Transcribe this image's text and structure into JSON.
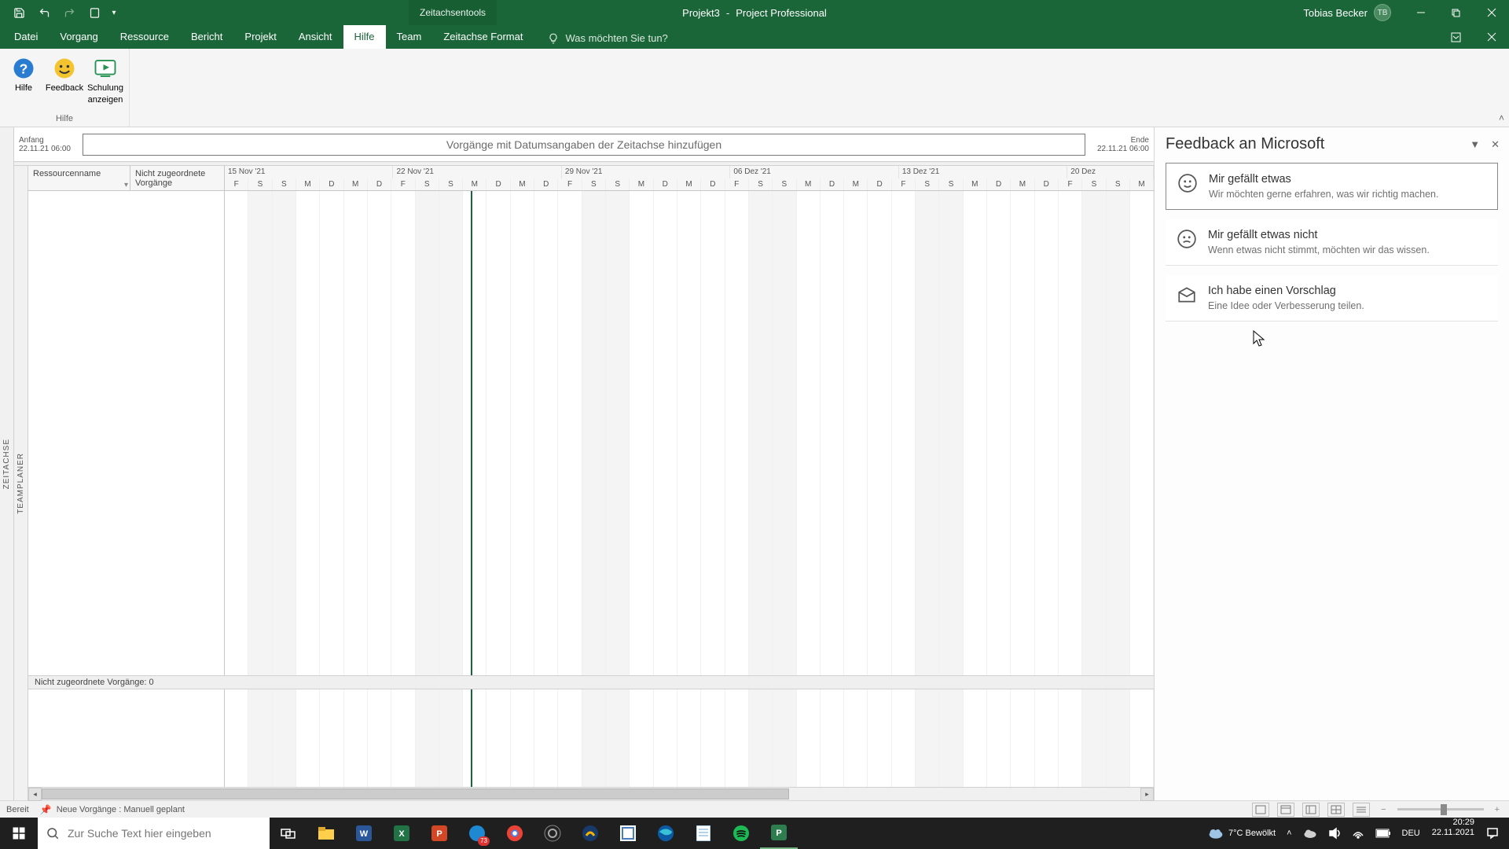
{
  "titlebar": {
    "contextual_tab": "Zeitachsentools",
    "doc_name": "Projekt3",
    "app_name": "Project Professional",
    "user_name": "Tobias Becker",
    "user_initials": "TB"
  },
  "ribbon_tabs": {
    "items": [
      "Datei",
      "Vorgang",
      "Ressource",
      "Bericht",
      "Projekt",
      "Ansicht",
      "Hilfe",
      "Team",
      "Zeitachse Format"
    ],
    "active_index": 6,
    "tellme_placeholder": "Was möchten Sie tun?"
  },
  "ribbon": {
    "help_group_label": "Hilfe",
    "buttons": {
      "help": "Hilfe",
      "feedback": "Feedback",
      "training_l1": "Schulung",
      "training_l2": "anzeigen"
    }
  },
  "timeline": {
    "side_label": "ZEITACHSE",
    "start_label": "Anfang",
    "start_date": "22.11.21 06:00",
    "end_label": "Ende",
    "end_date": "22.11.21 06:00",
    "placeholder": "Vorgänge mit Datumsangaben der Zeitachse hinzufügen"
  },
  "teamplanner": {
    "side_label": "TEAMPLANER",
    "cols": {
      "resource_name": "Ressourcenname",
      "unassigned_l1": "Nicht zugeordnete",
      "unassigned_l2": "Vorgänge"
    },
    "weeks": [
      "15 Nov '21",
      "22 Nov '21",
      "29 Nov '21",
      "06 Dez '21",
      "13 Dez '21",
      "20 Dez"
    ],
    "day_pattern": [
      "F",
      "S",
      "S",
      "M",
      "D",
      "M",
      "D",
      "F",
      "S",
      "S",
      "M",
      "D",
      "M",
      "D",
      "F",
      "S",
      "S",
      "M",
      "D",
      "M",
      "D",
      "F",
      "S",
      "S",
      "M",
      "D",
      "M",
      "D",
      "F",
      "S",
      "S",
      "M",
      "D",
      "M",
      "D",
      "F",
      "S",
      "S",
      "M"
    ],
    "weekend_idx": [
      1,
      2,
      8,
      9,
      15,
      16,
      22,
      23,
      29,
      30,
      36,
      37
    ],
    "unassigned_bar": "Nicht zugeordnete Vorgänge: 0"
  },
  "feedback_pane": {
    "title": "Feedback an Microsoft",
    "options": [
      {
        "title": "Mir gefällt etwas",
        "desc": "Wir möchten gerne erfahren, was wir richtig machen.",
        "icon": "smile"
      },
      {
        "title": "Mir gefällt etwas nicht",
        "desc": "Wenn etwas nicht stimmt, möchten wir das wissen.",
        "icon": "frown"
      },
      {
        "title": "Ich habe einen Vorschlag",
        "desc": "Eine Idee oder Verbesserung teilen.",
        "icon": "box"
      }
    ]
  },
  "statusbar": {
    "ready": "Bereit",
    "new_tasks": "Neue Vorgänge : Manuell geplant"
  },
  "taskbar": {
    "search_placeholder": "Zur Suche Text hier eingeben",
    "weather": "7°C  Bewölkt",
    "lang": "DEU",
    "time": "20:29",
    "date": "22.11.2021",
    "edge_badge": "73"
  }
}
